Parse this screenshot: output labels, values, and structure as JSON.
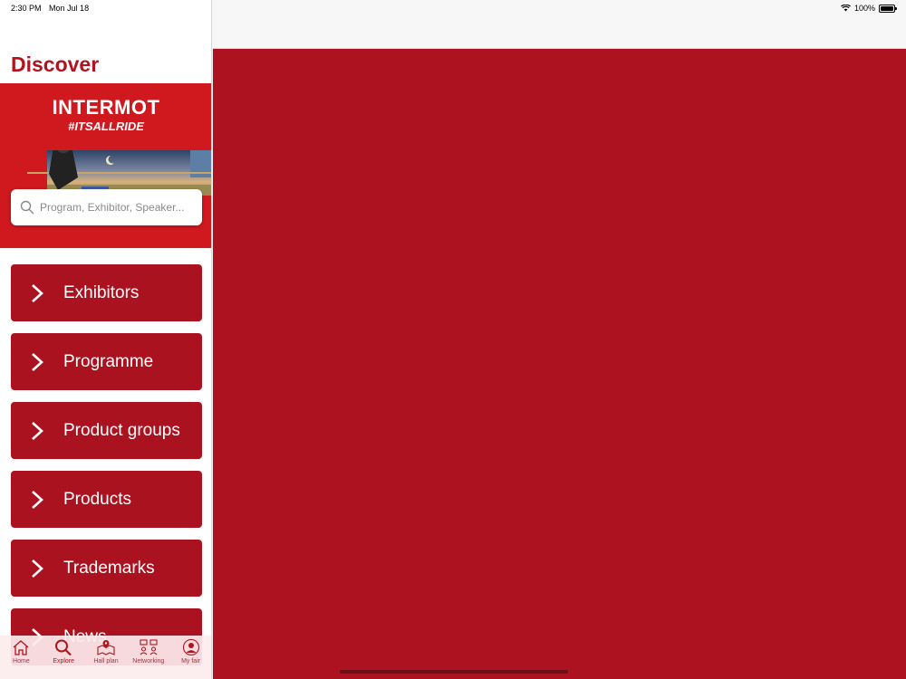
{
  "status": {
    "time": "2:30 PM",
    "date": "Mon Jul 18",
    "battery": "100%"
  },
  "sidebar": {
    "title": "Discover",
    "hero": {
      "brand": "INTERMOT",
      "tagline": "#ITSALLRIDE"
    },
    "search": {
      "placeholder": "Program, Exhibitor, Speaker..."
    },
    "menu": [
      {
        "label": "Exhibitors"
      },
      {
        "label": "Programme"
      },
      {
        "label": "Product groups"
      },
      {
        "label": "Products"
      },
      {
        "label": "Trademarks"
      },
      {
        "label": "News"
      }
    ]
  },
  "tabbar": {
    "tabs": [
      {
        "label": "Home",
        "icon": "home-icon"
      },
      {
        "label": "Explore",
        "icon": "search-icon"
      },
      {
        "label": "Hall plan",
        "icon": "map-icon"
      },
      {
        "label": "Networking",
        "icon": "networking-icon"
      },
      {
        "label": "My fair",
        "icon": "profile-icon"
      }
    ],
    "active": "Explore"
  },
  "colors": {
    "brand": "#b0141f",
    "menu_bg": "#ab121f",
    "detail_bg": "#ad1221"
  }
}
